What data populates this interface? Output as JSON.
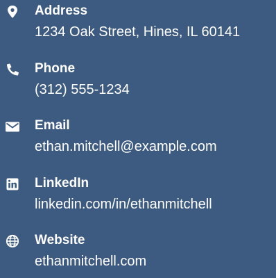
{
  "colors": {
    "background": "#3d5a80",
    "text": "#ffffff"
  },
  "contacts": [
    {
      "icon": "map-pin-icon",
      "label": "Address",
      "value": "1234 Oak Street, Hines, IL 60141"
    },
    {
      "icon": "phone-icon",
      "label": "Phone",
      "value": "(312) 555-1234"
    },
    {
      "icon": "envelope-icon",
      "label": "Email",
      "value": "ethan.mitchell@example.com"
    },
    {
      "icon": "linkedin-icon",
      "label": "LinkedIn",
      "value": "linkedin.com/in/ethanmitchell"
    },
    {
      "icon": "globe-icon",
      "label": "Website",
      "value": "ethanmitchell.com"
    }
  ]
}
